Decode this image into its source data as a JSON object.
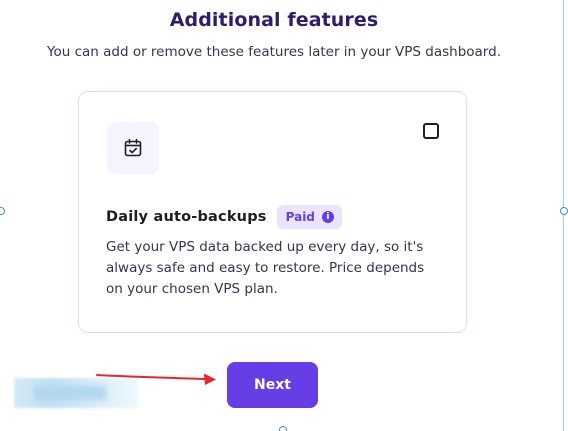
{
  "header": {
    "title": "Additional features",
    "subtitle": "You can add or remove these features later in your VPS dashboard."
  },
  "feature": {
    "icon": "calendar-check-icon",
    "title": "Daily auto-backups",
    "badge": "Paid",
    "badge_icon": "info-icon",
    "badge_icon_glyph": "i",
    "description": "Get your VPS data backed up every day, so it's always safe and easy to restore. Price depends on your chosen VPS plan.",
    "checked": false
  },
  "actions": {
    "next_label": "Next"
  },
  "colors": {
    "title": "#2f1c6a",
    "accent": "#673de6",
    "badge_bg": "#ebe4ff",
    "card_border": "#d5dfff",
    "annotation_arrow": "#e8252b"
  }
}
